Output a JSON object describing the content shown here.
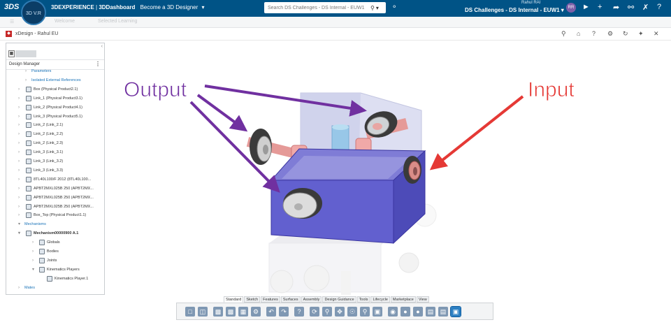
{
  "topbar": {
    "brand_bold": "3DEXPERIENCE",
    "brand_sep": " | ",
    "dashboard": "3DDashboard",
    "dashboard_tab": "Become a 3D Designer",
    "search_placeholder": "Search DS Challenges - DS Internal - EUW1",
    "user_name": "Rahul RAI",
    "tenant": "DS Challenges - DS Internal - EUW1",
    "avatar_initials": "RR",
    "compass_label": "3D V.R",
    "colors": {
      "bar": "#005386",
      "avatar": "#7b5ea7"
    }
  },
  "subbar": {
    "items": [
      "Welcome",
      "Selected Learning"
    ]
  },
  "app": {
    "title": "xDesign - Rahul EU"
  },
  "panel": {
    "title": "Design Manager",
    "tree": [
      {
        "label": "Parameters",
        "level": 1,
        "type": "link"
      },
      {
        "label": "Isolated External References",
        "level": 1,
        "type": "link"
      },
      {
        "label": "Box (Physical Product2.1)",
        "level": 1,
        "type": "part"
      },
      {
        "label": "Link_1 (Physical Product3.1)",
        "level": 1,
        "type": "part"
      },
      {
        "label": "Link_2 (Physical Product4.1)",
        "level": 1,
        "type": "part"
      },
      {
        "label": "Link_3 (Physical Product5.1)",
        "level": 1,
        "type": "part"
      },
      {
        "label": "Link_2 (Link_2.1)",
        "level": 1,
        "type": "part"
      },
      {
        "label": "Link_2 (Link_2.2)",
        "level": 1,
        "type": "part"
      },
      {
        "label": "Link_2 (Link_2.3)",
        "level": 1,
        "type": "part"
      },
      {
        "label": "Link_3 (Link_3.1)",
        "level": 1,
        "type": "part"
      },
      {
        "label": "Link_3 (Link_3.2)",
        "level": 1,
        "type": "part"
      },
      {
        "label": "Link_3 (Link_3.3)",
        "level": 1,
        "type": "part"
      },
      {
        "label": "8TL40L100/F 2012 (8TL40L100...",
        "level": 1,
        "type": "part"
      },
      {
        "label": "APBT2MXL025B 250 (APBT2MX...",
        "level": 1,
        "type": "part"
      },
      {
        "label": "APBT2MXL025B 250 (APBT2MX...",
        "level": 1,
        "type": "part"
      },
      {
        "label": "APBT2MXL025B 250 (APBT2MX...",
        "level": 1,
        "type": "part"
      },
      {
        "label": "Box_Top (Physical Product1.1)",
        "level": 1,
        "type": "part"
      },
      {
        "label": "Mechanisms",
        "level": 0,
        "type": "link"
      },
      {
        "label": "Mechanism00000900 A.1",
        "level": 1,
        "type": "bold"
      },
      {
        "label": "Globals",
        "level": 2,
        "type": "part"
      },
      {
        "label": "Bodies",
        "level": 2,
        "type": "part"
      },
      {
        "label": "Joints",
        "level": 2,
        "type": "part"
      },
      {
        "label": "Kinematics Players",
        "level": 2,
        "type": "part"
      },
      {
        "label": "Kinematics Player.1",
        "level": 3,
        "type": "part"
      },
      {
        "label": "Mates",
        "level": 0,
        "type": "link"
      }
    ]
  },
  "annotations": {
    "output": "Output",
    "input": "Input",
    "output_color": "#7030a0",
    "input_color": "#e53935"
  },
  "tabs": [
    "Standard",
    "Sketch",
    "Features",
    "Surfaces",
    "Assembly",
    "Design Guidance",
    "Tools",
    "Lifecycle",
    "Marketplace",
    "View"
  ],
  "active_tab": "Standard",
  "action_icons": [
    "new-icon",
    "open-icon",
    "save-icon",
    "save-as-icon",
    "properties-icon",
    "settings-icon",
    "undo-icon",
    "redo-icon",
    "help-icon",
    "rotate-icon",
    "zoom-icon",
    "pan-icon",
    "look-at-icon",
    "fit-all-icon",
    "view-cube-icon",
    "hide-icon",
    "render-icon",
    "color-icon",
    "section-icon",
    "capture-icon",
    "display-icon"
  ]
}
